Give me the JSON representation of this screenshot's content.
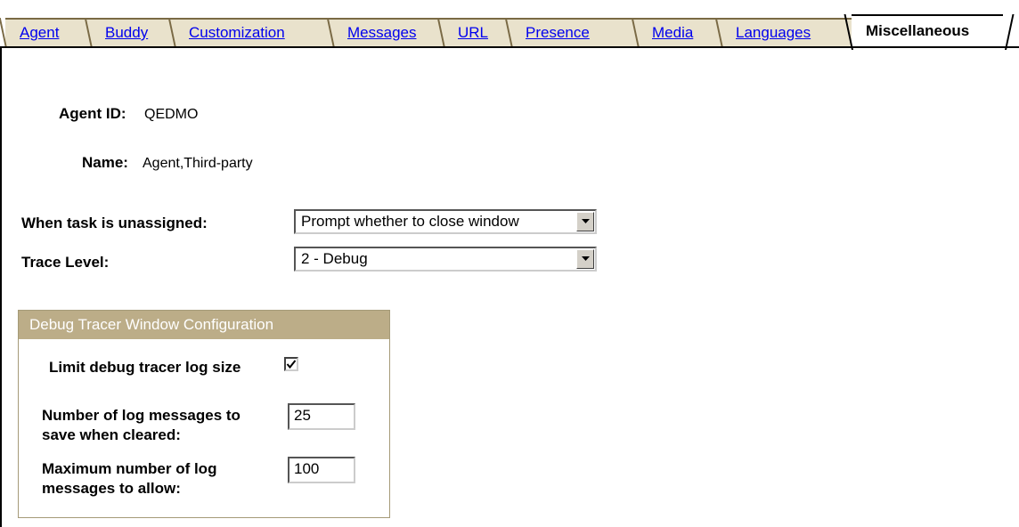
{
  "tabs": [
    {
      "label": "Agent"
    },
    {
      "label": "Buddy"
    },
    {
      "label": "Customization"
    },
    {
      "label": "Messages"
    },
    {
      "label": "URL"
    },
    {
      "label": "Presence"
    },
    {
      "label": "Media"
    },
    {
      "label": "Languages"
    },
    {
      "label": "Miscellaneous",
      "active": true
    }
  ],
  "agent": {
    "id_label": "Agent ID:",
    "id_value": "QEDMO",
    "name_label": "Name:",
    "name_value": "Agent,Third-party"
  },
  "settings": {
    "unassigned_label": "When task is unassigned:",
    "unassigned_value": "Prompt whether to close window",
    "trace_label": "Trace Level:",
    "trace_value": "2 - Debug"
  },
  "debug_group": {
    "title": "Debug Tracer Window Configuration",
    "limit_label": "Limit debug tracer log size",
    "limit_checked": true,
    "save_label_line1": "Number of log messages to",
    "save_label_line2": "save when cleared:",
    "save_value": "25",
    "max_label_line1": "Maximum number of log",
    "max_label_line2": "messages to allow:",
    "max_value": "100"
  },
  "colors": {
    "link": "#0000ee",
    "tab_bg": "#e9e2cc",
    "group_header_bg": "#bcad88"
  }
}
